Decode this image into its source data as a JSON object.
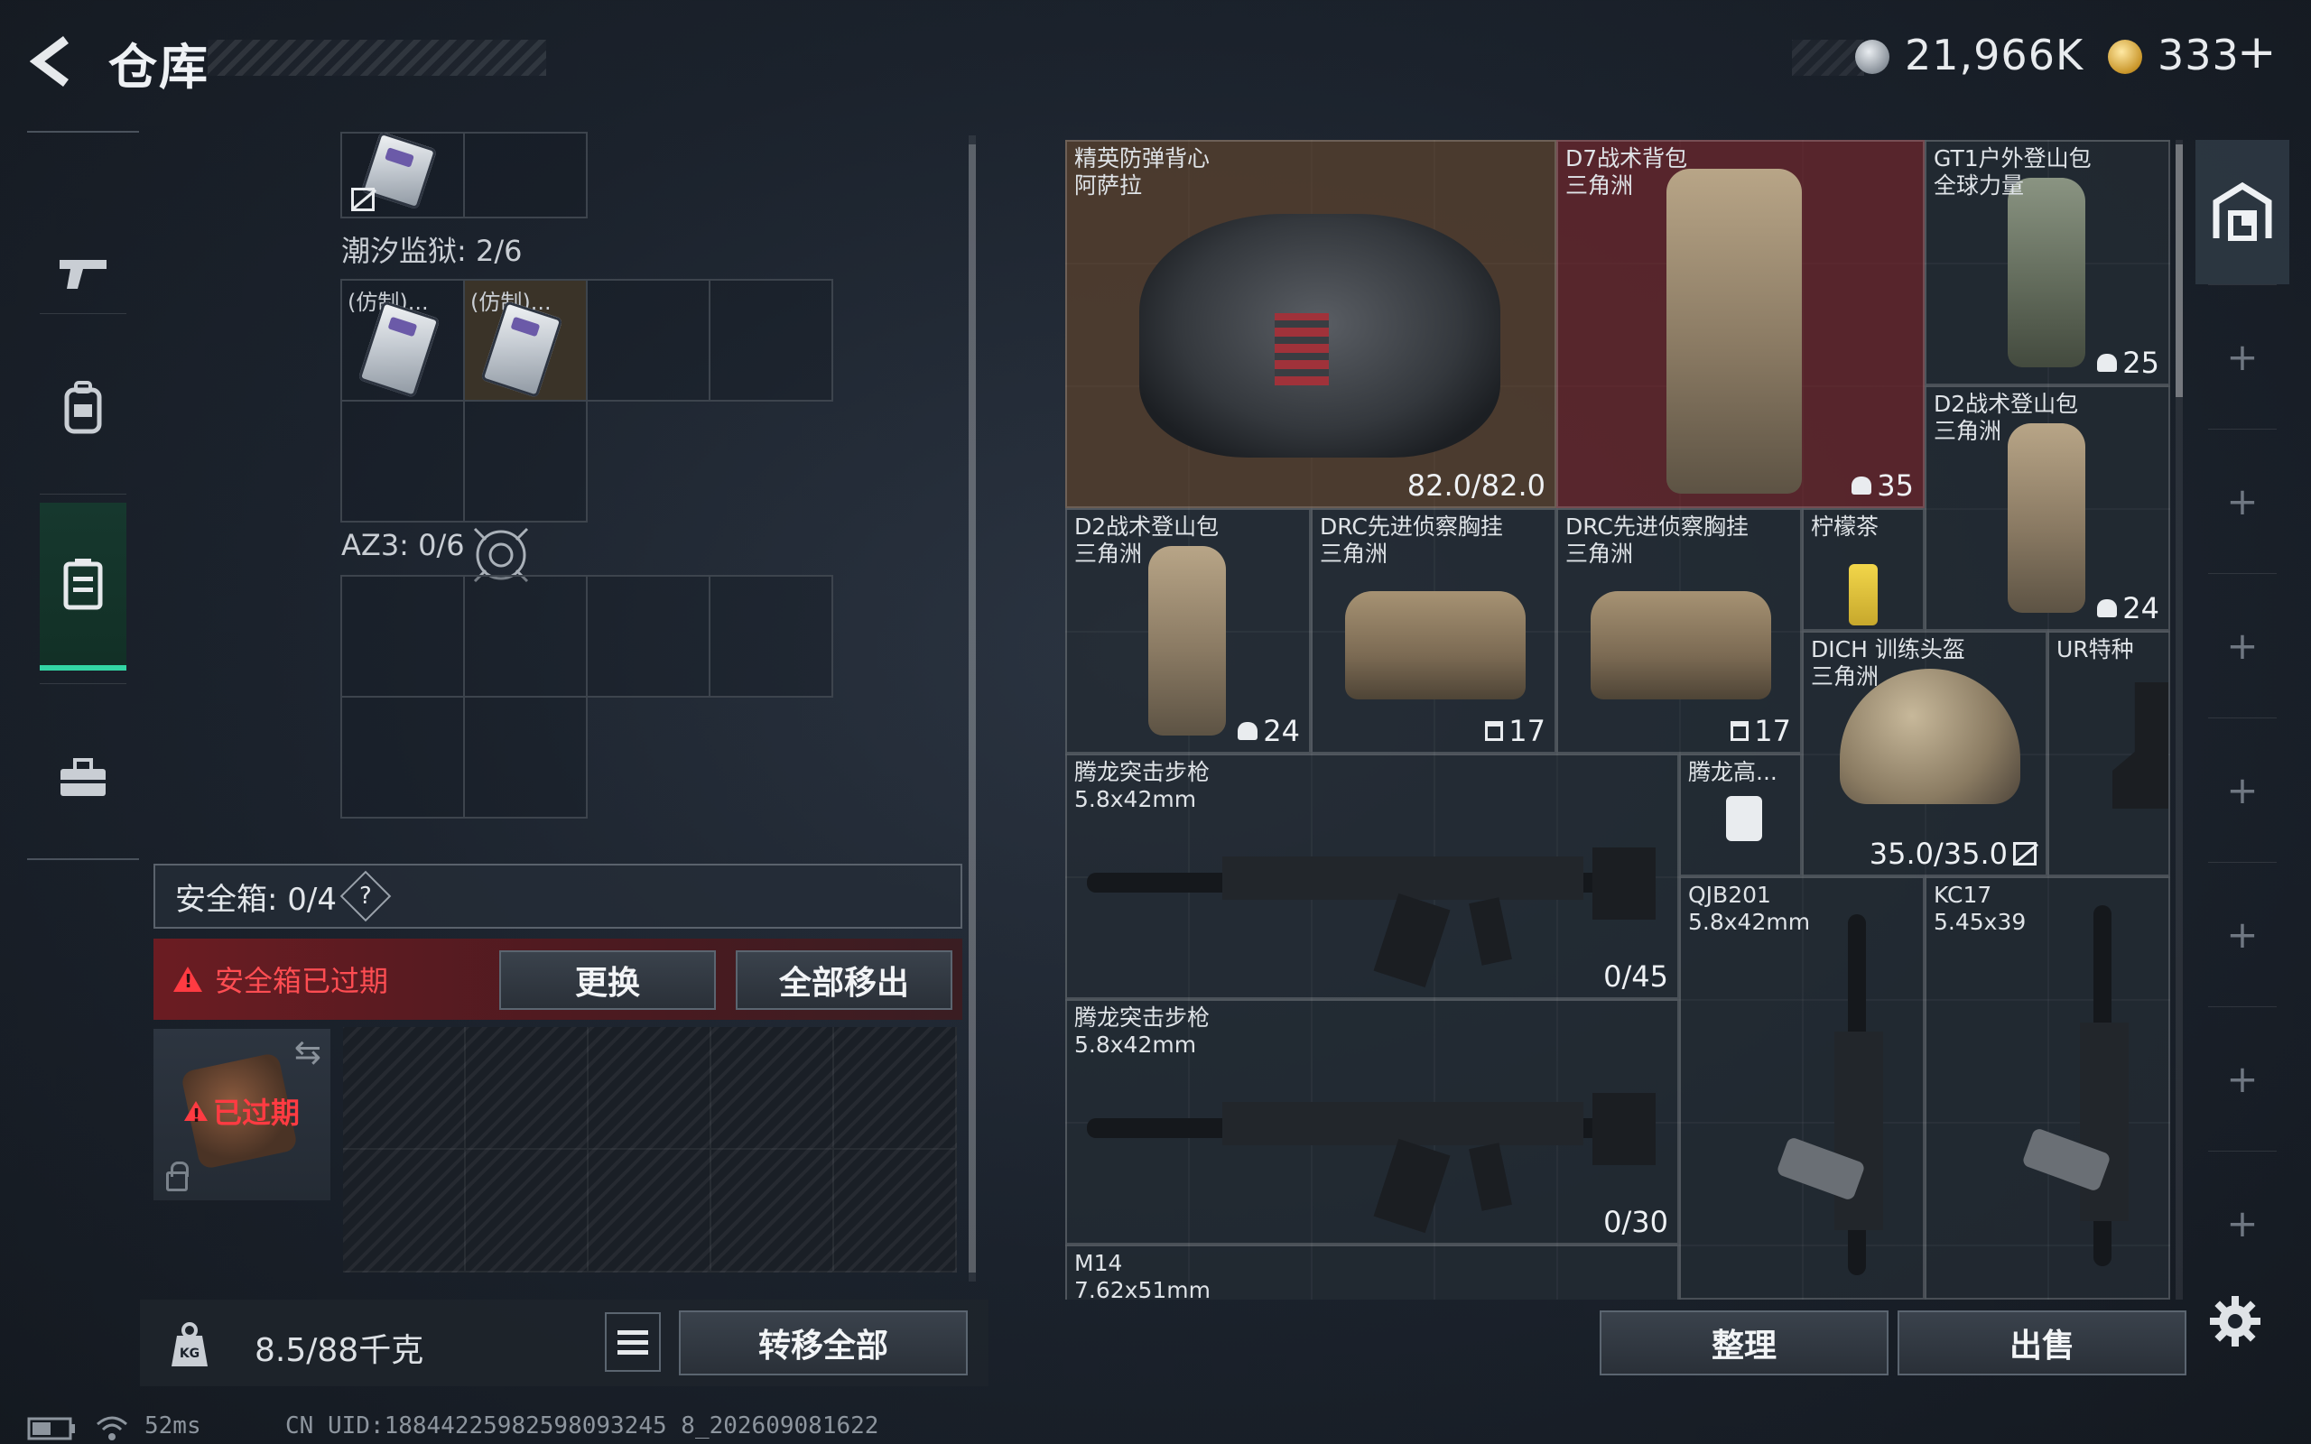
{
  "header": {
    "title": "仓库",
    "silver_value": "21,966K",
    "gold_value": "333",
    "gold_add": "+"
  },
  "left_nav": {
    "items": [
      {
        "name": "weapons",
        "icon": "gun-icon"
      },
      {
        "name": "equipment",
        "icon": "backpack-icon"
      },
      {
        "name": "container",
        "icon": "container-icon",
        "active": true
      },
      {
        "name": "inventory",
        "icon": "toolbox-icon"
      }
    ]
  },
  "backpack": {
    "top_cards": [
      {
        "label": ""
      }
    ],
    "prison_label": "潮汐监狱: 2/6",
    "prison_cards": [
      {
        "label": "(仿制)..."
      },
      {
        "label": "(仿制)..."
      }
    ],
    "az3_label": "AZ3: 0/6"
  },
  "safe_box": {
    "header": "安全箱: 0/4",
    "help": "?",
    "warning": "安全箱已过期",
    "replace_label": "更换",
    "remove_all_label": "全部移出",
    "expired_tag": "已过期"
  },
  "weight": {
    "value": "8.5/88千克"
  },
  "bottom_left": {
    "transfer_label": "转移全部"
  },
  "stash": {
    "items": [
      {
        "id": "vest",
        "name": "精英防弹背心\n阿萨拉",
        "qty": "82.0/82.0"
      },
      {
        "id": "d7",
        "name": "D7战术背包\n三角洲",
        "qty": "35"
      },
      {
        "id": "gt1",
        "name": "GT1户外登山包\n全球力量",
        "qty": "25"
      },
      {
        "id": "d2a",
        "name": "D2战术登山包\n三角洲",
        "qty": "24"
      },
      {
        "id": "d2b",
        "name": "D2战术登山包\n三角洲",
        "qty": "24"
      },
      {
        "id": "drc1",
        "name": "DRC先进侦察胸挂\n三角洲",
        "qty": "17"
      },
      {
        "id": "drc2",
        "name": "DRC先进侦察胸挂\n三角洲",
        "qty": "17"
      },
      {
        "id": "tea",
        "name": "柠檬茶",
        "qty": ""
      },
      {
        "id": "helmet",
        "name": "DICH 训练头盔\n三角洲",
        "qty": "35.0/35.0"
      },
      {
        "id": "ur",
        "name": "UR特种",
        "qty": ""
      },
      {
        "id": "rifle1",
        "name": "腾龙突击步枪\n5.8x42mm",
        "qty": "0/45"
      },
      {
        "id": "tenglong",
        "name": "腾龙高...",
        "qty": ""
      },
      {
        "id": "rifle2",
        "name": "腾龙突击步枪\n5.8x42mm",
        "qty": "0/30"
      },
      {
        "id": "qjb",
        "name": "QJB201\n5.8x42mm",
        "qty": ""
      },
      {
        "id": "kc17",
        "name": "KC17\n5.45x39",
        "qty": ""
      },
      {
        "id": "m14",
        "name": "M14\n7.62x51mm",
        "qty": ""
      }
    ]
  },
  "bottom_right": {
    "sort_label": "整理",
    "sell_label": "出售"
  },
  "status_bar": {
    "ping": "52ms",
    "uid": "CN UID:18844225982598093245 8_202609081622"
  },
  "colors": {
    "accent": "#33d6a4",
    "warning": "#ff3b42",
    "brown_bg": "#5c4432",
    "red_bg": "#68282e"
  }
}
